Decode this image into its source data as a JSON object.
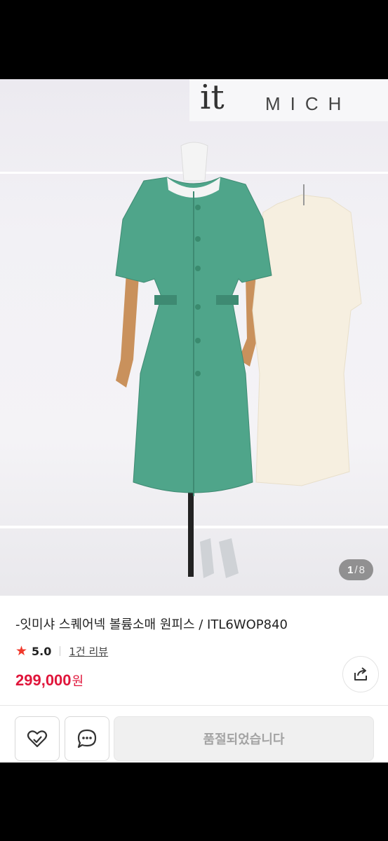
{
  "product": {
    "title": "-잇미샤 스퀘어넥 볼륨소매 원피스 / ITL6WOP840",
    "rating": "5.0",
    "review_link": "1건 리뷰",
    "price": "299,000",
    "currency": "원"
  },
  "gallery": {
    "current_page": "1",
    "separator": "/",
    "total_pages": "8",
    "store_sign_logo": "it",
    "store_sign_text": "MICH"
  },
  "actions": {
    "buy_label": "품절되었습니다"
  },
  "colors": {
    "accent_red": "#e0163b",
    "star": "#f0392b",
    "dress_green": "#4fa58a",
    "disabled_text": "#a3a3a3"
  },
  "icons": {
    "rating": "star-icon",
    "share": "share-icon",
    "favorite": "heart-icon",
    "chat": "chat-bubble-icon"
  }
}
